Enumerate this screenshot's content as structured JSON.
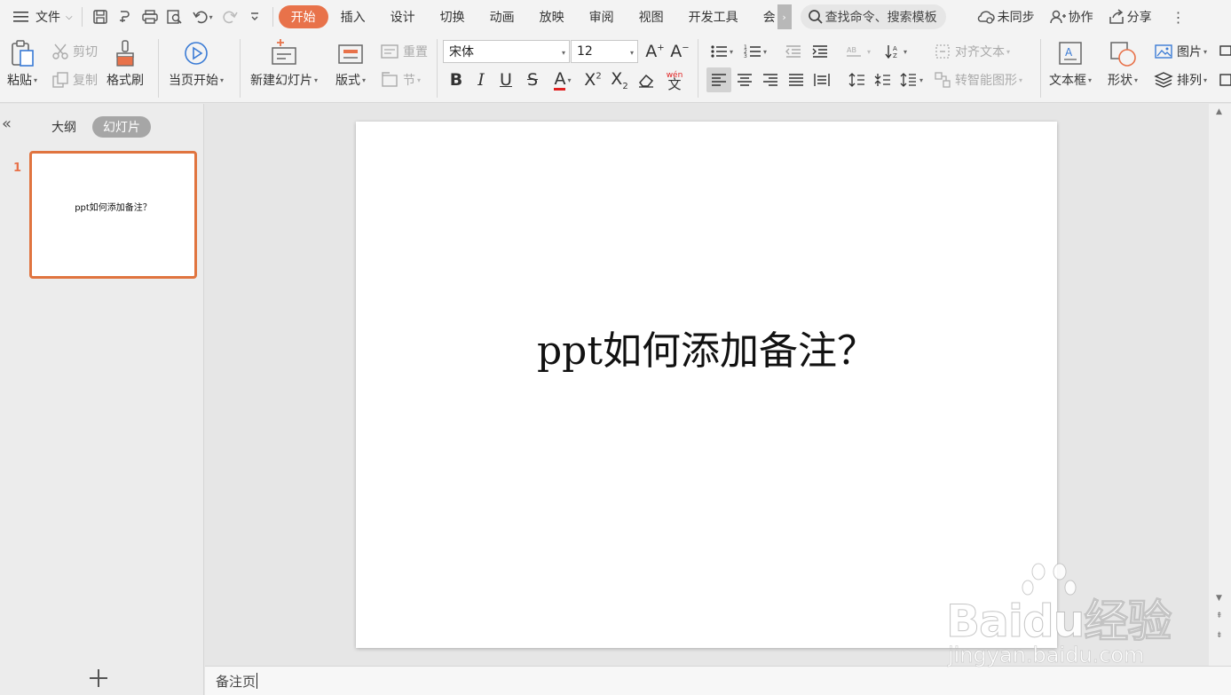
{
  "menubar": {
    "file": "文件",
    "tabs": [
      "开始",
      "插入",
      "设计",
      "切换",
      "动画",
      "放映",
      "审阅",
      "视图",
      "开发工具",
      "会"
    ],
    "active_tab": "开始",
    "search_placeholder": "查找命令、搜索模板",
    "sync": "未同步",
    "collab": "协作",
    "share": "分享"
  },
  "ribbon": {
    "paste": "粘贴",
    "cut": "剪切",
    "copy": "复制",
    "format_painter": "格式刷",
    "from_current": "当页开始",
    "new_slide": "新建幻灯片",
    "layout": "版式",
    "reset": "重置",
    "section": "节",
    "font_name": "宋体",
    "font_size": "12",
    "align_text": "对齐文本",
    "smartart": "转智能图形",
    "textbox": "文本框",
    "shape": "形状",
    "picture": "图片",
    "arrange": "排列",
    "phonetic": "wén"
  },
  "leftpanel": {
    "tab_outline": "大纲",
    "tab_slides": "幻灯片",
    "slide_number": "1",
    "thumb_title": "ppt如何添加备注？"
  },
  "slide": {
    "title": "ppt如何添加备注？"
  },
  "notes": {
    "label": "备注页"
  },
  "watermark": {
    "brand": "Baidu经验",
    "url": "jingyan.baidu.com"
  },
  "colors": {
    "accent": "#e8724a",
    "thumb_border": "#e0743f",
    "font_color_red": "#e02020"
  }
}
